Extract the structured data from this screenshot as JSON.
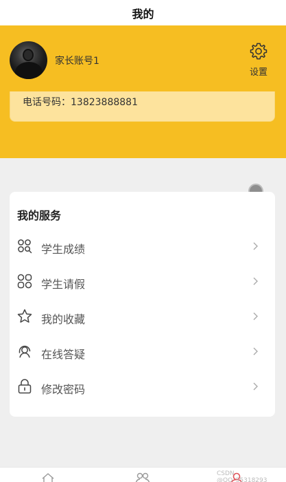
{
  "topbar": {
    "title": "我的"
  },
  "profile": {
    "account_name": "家长账号1",
    "settings_label": "设置",
    "phone_text": "电话号码：13823888881"
  },
  "services": {
    "title": "我的服务",
    "items": [
      {
        "label": "学生成绩",
        "icon": "grid-search-icon"
      },
      {
        "label": "学生请假",
        "icon": "apps-icon"
      },
      {
        "label": "我的收藏",
        "icon": "star-icon"
      },
      {
        "label": "在线答疑",
        "icon": "support-person-icon"
      },
      {
        "label": "修改密码",
        "icon": "lock-icon"
      }
    ]
  },
  "bottom_nav": {
    "items": [
      {
        "icon": "home-icon",
        "active": false
      },
      {
        "icon": "group-icon",
        "active": false
      },
      {
        "icon": "profile-icon",
        "active": true
      }
    ]
  },
  "watermark": "CSDN @QQ_55318293",
  "colors": {
    "brand_yellow": "#f6be22",
    "card_yellow": "#fde39d",
    "active_nav": "#e0535a"
  }
}
